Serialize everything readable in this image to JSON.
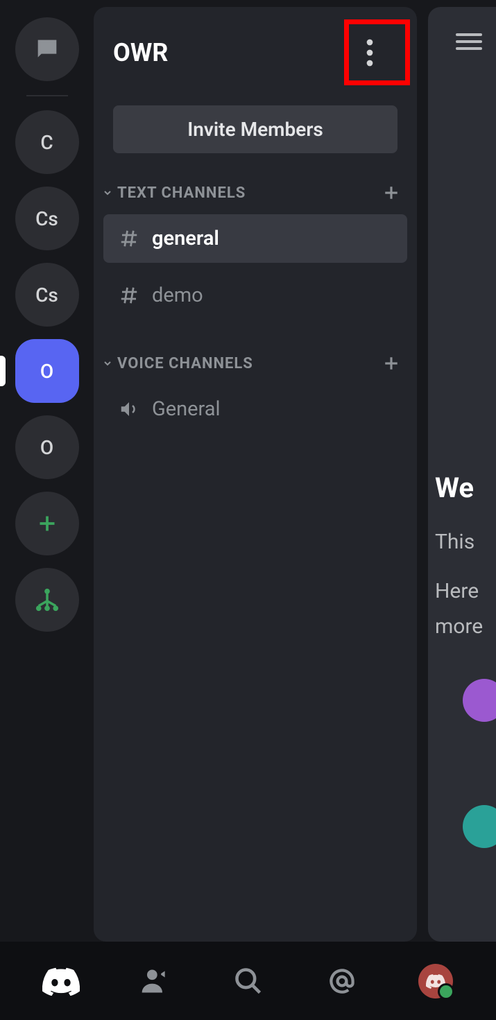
{
  "server": {
    "name": "OWR",
    "invite_label": "Invite Members"
  },
  "guilds": [
    {
      "label": "",
      "kind": "dm"
    },
    {
      "label": "C",
      "kind": "server"
    },
    {
      "label": "Cs",
      "kind": "server"
    },
    {
      "label": "Cs",
      "kind": "server"
    },
    {
      "label": "O",
      "kind": "server",
      "active": true
    },
    {
      "label": "O",
      "kind": "server"
    }
  ],
  "categories": {
    "text": {
      "label": "TEXT CHANNELS",
      "channels": [
        {
          "name": "general",
          "selected": true
        },
        {
          "name": "demo",
          "selected": false
        }
      ]
    },
    "voice": {
      "label": "VOICE CHANNELS",
      "channels": [
        {
          "name": "General"
        }
      ]
    }
  },
  "chat_peek": {
    "welcome": "We",
    "line1": "This",
    "line2": "Here",
    "line3": "more"
  }
}
